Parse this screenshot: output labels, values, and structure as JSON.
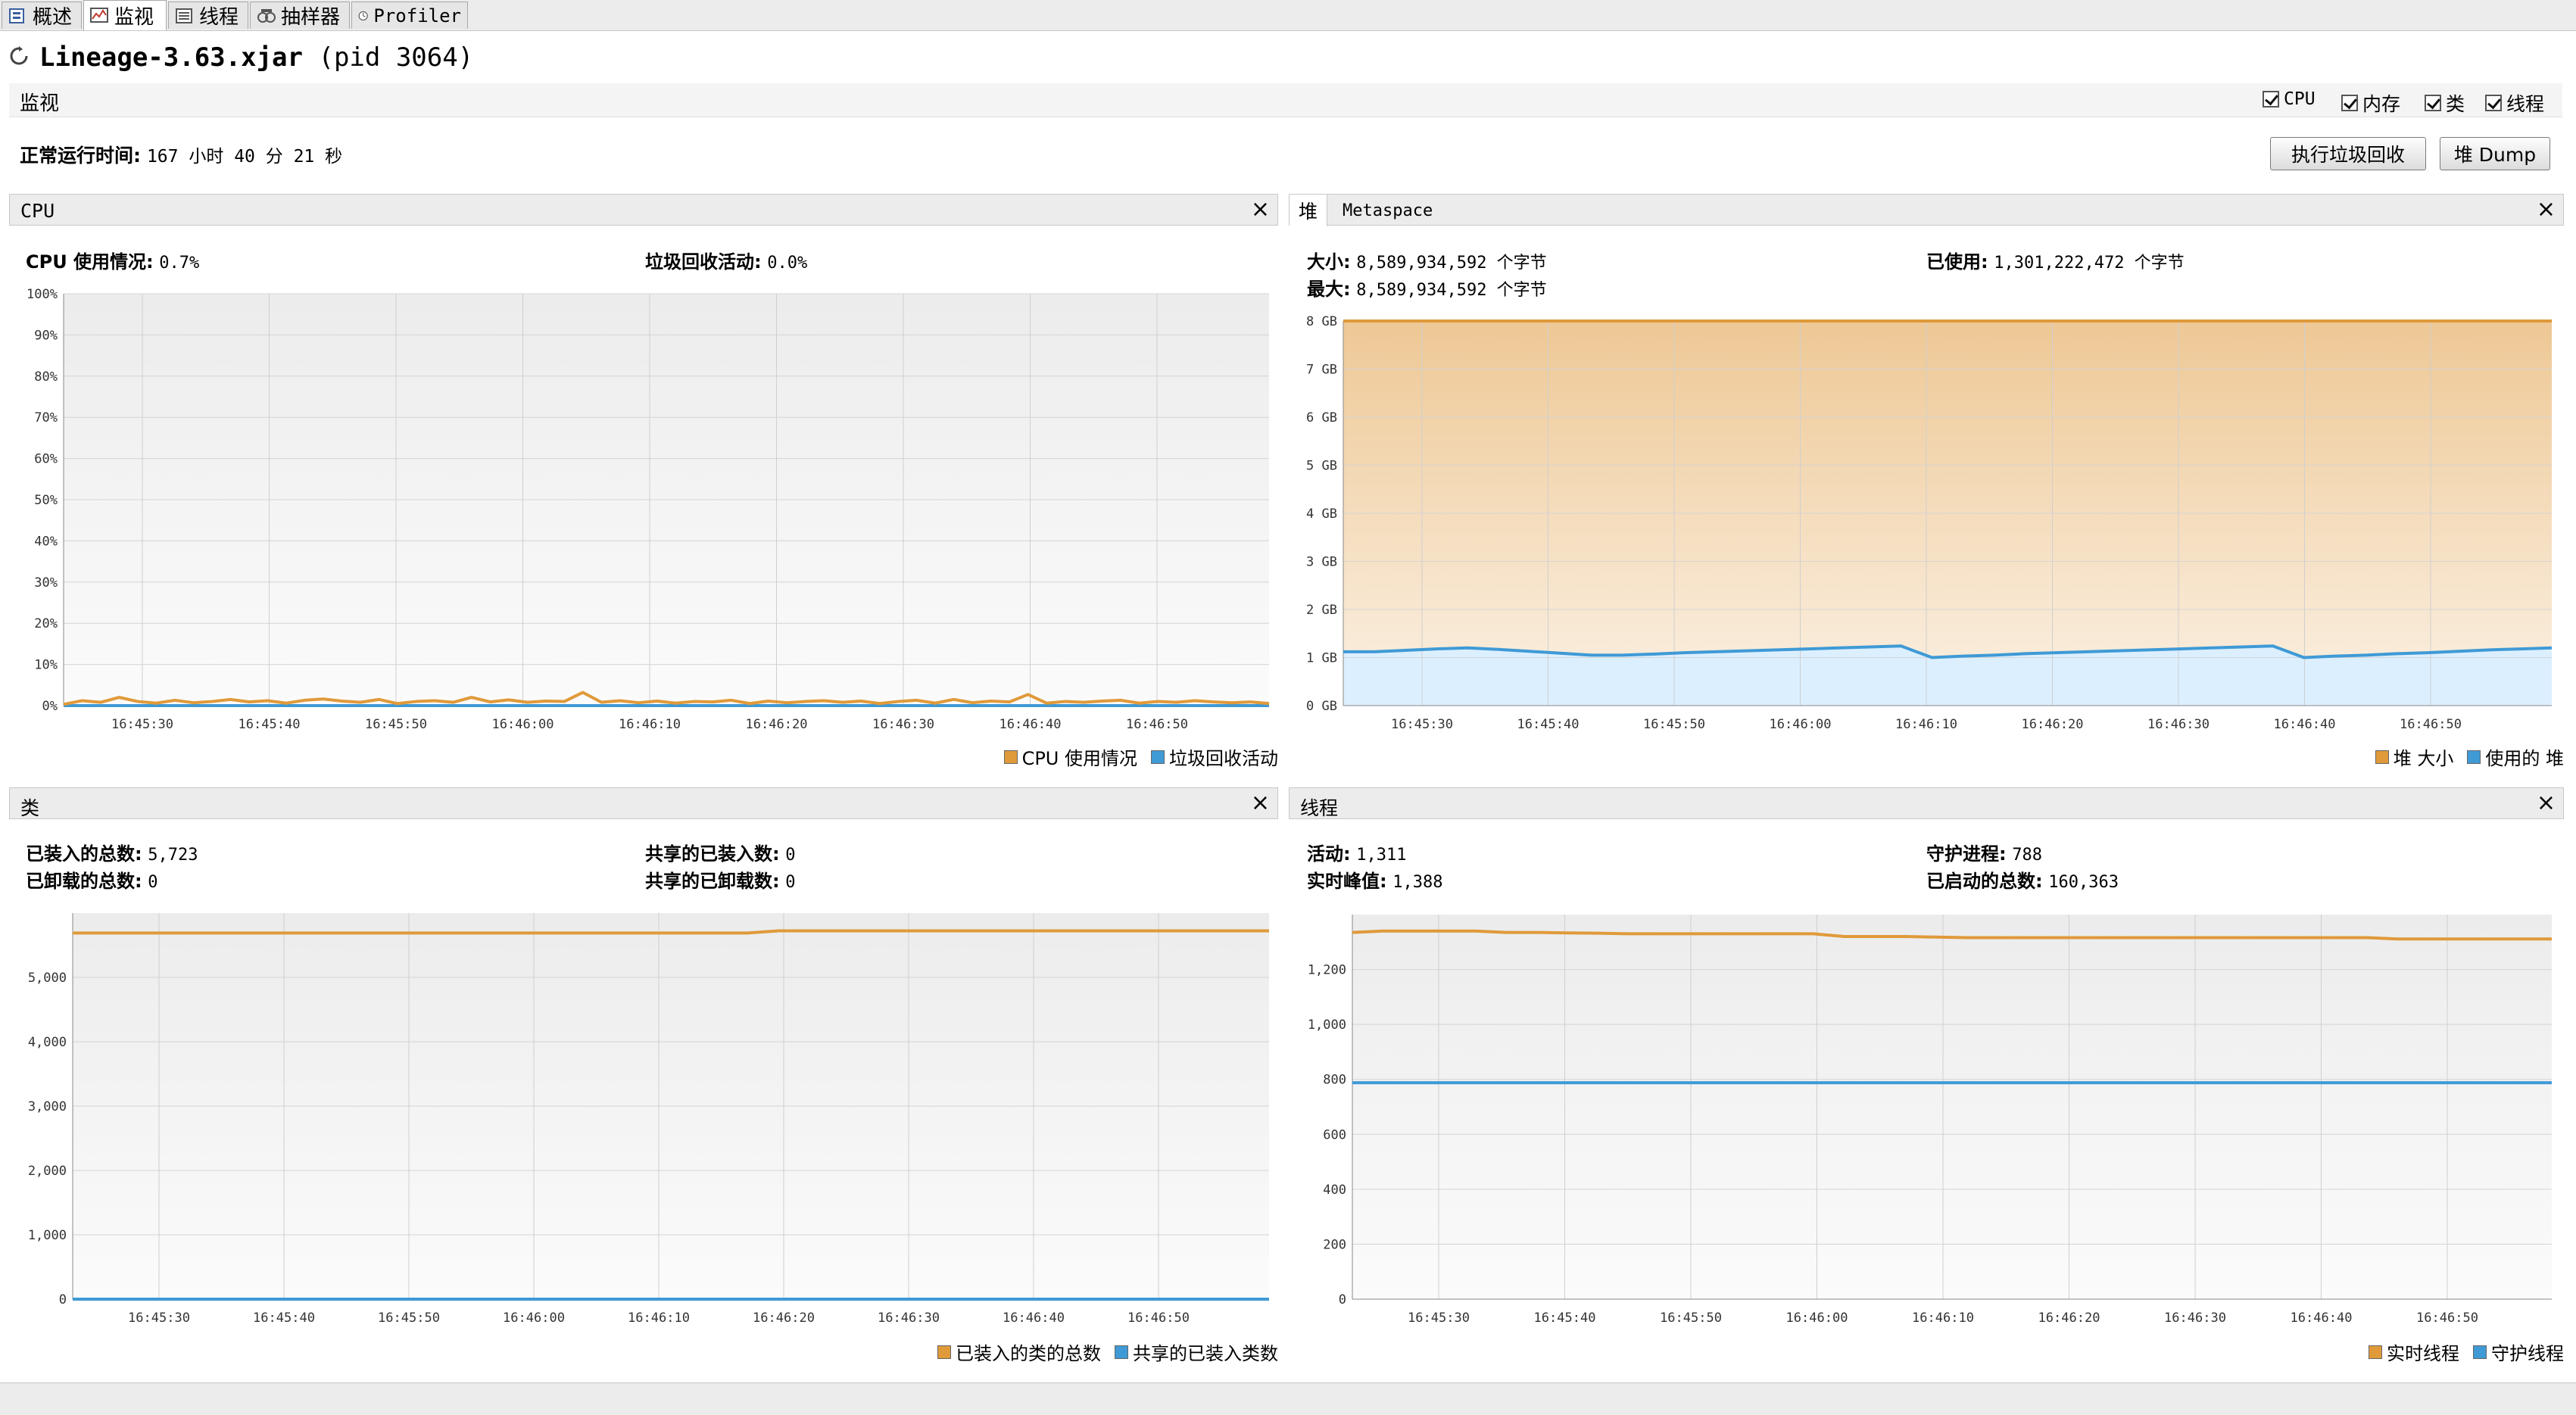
{
  "tabs": [
    {
      "label": "概述",
      "icon": "overview-icon"
    },
    {
      "label": "监视",
      "icon": "monitor-chart-icon"
    },
    {
      "label": "线程",
      "icon": "threads-icon"
    },
    {
      "label": "抽样器",
      "icon": "sampler-icon"
    },
    {
      "label": "Profiler",
      "icon": "profiler-clock-icon"
    }
  ],
  "app": {
    "name": "Lineage-3.63.xjar",
    "pid": "(pid 3064)"
  },
  "section": {
    "label": "监视"
  },
  "toggles": [
    {
      "label": "CPU",
      "checked": true
    },
    {
      "label": "内存",
      "checked": true
    },
    {
      "label": "类",
      "checked": true
    },
    {
      "label": "线程",
      "checked": true
    }
  ],
  "uptime": {
    "label": "正常运行时间:",
    "value": "167 小时 40 分 21 秒"
  },
  "buttons": {
    "gc": "执行垃圾回收",
    "heap_dump": "堆 Dump"
  },
  "colors": {
    "orange": "#e09a3a",
    "blue": "#3f9ad6"
  },
  "cpu": {
    "title": "CPU",
    "usage_label": "CPU 使用情况:",
    "usage_value": "0.7%",
    "gc_label": "垃圾回收活动:",
    "gc_value": "0.0%",
    "legend": [
      "CPU 使用情况",
      "垃圾回收活动"
    ]
  },
  "heap": {
    "tabs": [
      "堆",
      "Metaspace"
    ],
    "size_label": "大小:",
    "size_value": "8,589,934,592 个字节",
    "max_label": "最大:",
    "max_value": "8,589,934,592 个字节",
    "used_label": "已使用:",
    "used_value": "1,301,222,472 个字节",
    "legend": [
      "堆 大小",
      "使用的 堆"
    ]
  },
  "classes": {
    "title": "类",
    "loaded_label": "已装入的总数:",
    "loaded_value": "5,723",
    "unloaded_label": "已卸载的总数:",
    "unloaded_value": "0",
    "shared_loaded_label": "共享的已装入数:",
    "shared_loaded_value": "0",
    "shared_unloaded_label": "共享的已卸载数:",
    "shared_unloaded_value": "0",
    "legend": [
      "已装入的类的总数",
      "共享的已装入类数"
    ]
  },
  "threads": {
    "title": "线程",
    "live_label": "活动:",
    "live_value": "1,311",
    "peak_label": "实时峰值:",
    "peak_value": "1,388",
    "daemon_label": "守护进程:",
    "daemon_value": "788",
    "started_label": "已启动的总数:",
    "started_value": "160,363",
    "legend": [
      "实时线程",
      "守护线程"
    ]
  },
  "chart_data": [
    {
      "type": "line",
      "name": "cpu",
      "x_ticks": [
        "16:45:30",
        "16:45:40",
        "16:45:50",
        "16:46:00",
        "16:46:10",
        "16:46:20",
        "16:46:30",
        "16:46:40",
        "16:46:50"
      ],
      "y_ticks": [
        "0%",
        "10%",
        "20%",
        "30%",
        "40%",
        "50%",
        "60%",
        "70%",
        "80%",
        "90%",
        "100%"
      ],
      "ylim": [
        0,
        100
      ],
      "series": [
        {
          "name": "CPU 使用情况",
          "color": "#e09a3a",
          "values": [
            0.3,
            1.2,
            0.8,
            2,
            1,
            0.6,
            1.3,
            0.7,
            1,
            1.5,
            0.9,
            1.2,
            0.6,
            1.3,
            1.6,
            1.1,
            0.8,
            1.5,
            0.5,
            1,
            1.2,
            0.8,
            2,
            0.9,
            1.4,
            0.8,
            1.1,
            1,
            3.2,
            0.8,
            1.2,
            0.7,
            1.1,
            0.6,
            1,
            0.9,
            1.3,
            0.5,
            1.1,
            0.7,
            1,
            1.2,
            0.8,
            1.1,
            0.5,
            1,
            1.3,
            0.6,
            1.5,
            0.7,
            1.1,
            0.9,
            2.7,
            0.6,
            1,
            0.8,
            1.1,
            1.3,
            0.6,
            1,
            0.8,
            1.2,
            0.9,
            0.7,
            0.9,
            0.5
          ]
        },
        {
          "name": "垃圾回收活动",
          "color": "#3f9ad6",
          "values": [
            0,
            0,
            0,
            0,
            0,
            0,
            0,
            0,
            0,
            0,
            0,
            0,
            0,
            0,
            0,
            0,
            0,
            0,
            0,
            0
          ]
        }
      ]
    },
    {
      "type": "area",
      "name": "heap",
      "x_ticks": [
        "16:45:30",
        "16:45:40",
        "16:45:50",
        "16:46:00",
        "16:46:10",
        "16:46:20",
        "16:46:30",
        "16:46:40",
        "16:46:50"
      ],
      "y_ticks": [
        "0 GB",
        "1 GB",
        "2 GB",
        "3 GB",
        "4 GB",
        "5 GB",
        "6 GB",
        "7 GB",
        "8 GB"
      ],
      "ylim": [
        0,
        8
      ],
      "series": [
        {
          "name": "堆 大小",
          "color": "#e09a3a",
          "values": [
            8,
            8,
            8,
            8,
            8,
            8,
            8,
            8,
            8,
            8,
            8,
            8,
            8,
            8,
            8,
            8,
            8,
            8,
            8,
            8
          ]
        },
        {
          "name": "使用的 堆",
          "color": "#3f9ad6",
          "values": [
            1.12,
            1.12,
            1.15,
            1.18,
            1.2,
            1.17,
            1.13,
            1.09,
            1.05,
            1.05,
            1.07,
            1.1,
            1.12,
            1.14,
            1.16,
            1.18,
            1.2,
            1.22,
            1.24,
            1.0,
            1.03,
            1.05,
            1.08,
            1.1,
            1.12,
            1.14,
            1.16,
            1.18,
            1.2,
            1.22,
            1.24,
            1.0,
            1.03,
            1.05,
            1.08,
            1.1,
            1.13,
            1.16,
            1.18,
            1.2
          ]
        }
      ]
    },
    {
      "type": "line",
      "name": "classes",
      "x_ticks": [
        "16:45:30",
        "16:45:40",
        "16:45:50",
        "16:46:00",
        "16:46:10",
        "16:46:20",
        "16:46:30",
        "16:46:40",
        "16:46:50"
      ],
      "y_ticks": [
        "0",
        "1,000",
        "2,000",
        "3,000",
        "4,000",
        "5,000"
      ],
      "ylim": [
        0,
        6000
      ],
      "series": [
        {
          "name": "已装入的类的总数",
          "color": "#e09a3a",
          "values": [
            5690,
            5690,
            5690,
            5690,
            5690,
            5690,
            5690,
            5690,
            5690,
            5690,
            5690,
            5690,
            5690,
            5690,
            5690,
            5690,
            5690,
            5690,
            5690,
            5690,
            5690,
            5690,
            5690,
            5723,
            5723,
            5723,
            5723,
            5723,
            5723,
            5723,
            5723,
            5723,
            5723,
            5723,
            5723,
            5723,
            5723,
            5723,
            5723,
            5723
          ]
        },
        {
          "name": "共享的已装入类数",
          "color": "#3f9ad6",
          "values": [
            0,
            0,
            0,
            0,
            0,
            0,
            0,
            0,
            0,
            0,
            0,
            0,
            0,
            0,
            0,
            0,
            0,
            0,
            0,
            0
          ]
        }
      ]
    },
    {
      "type": "line",
      "name": "threads",
      "x_ticks": [
        "16:45:30",
        "16:45:40",
        "16:45:50",
        "16:46:00",
        "16:46:10",
        "16:46:20",
        "16:46:30",
        "16:46:40",
        "16:46:50"
      ],
      "y_ticks": [
        "0",
        "200",
        "400",
        "600",
        "800",
        "1,000",
        "1,200"
      ],
      "ylim": [
        0,
        1400
      ],
      "series": [
        {
          "name": "实时线程",
          "color": "#e09a3a",
          "values": [
            1335,
            1340,
            1340,
            1340,
            1340,
            1335,
            1335,
            1333,
            1332,
            1330,
            1330,
            1330,
            1330,
            1330,
            1330,
            1330,
            1320,
            1320,
            1320,
            1318,
            1316,
            1316,
            1316,
            1316,
            1316,
            1316,
            1316,
            1316,
            1316,
            1316,
            1316,
            1316,
            1316,
            1316,
            1311,
            1311,
            1311,
            1311,
            1311,
            1311
          ]
        },
        {
          "name": "守护线程",
          "color": "#3f9ad6",
          "values": [
            788,
            788,
            788,
            788,
            788,
            788,
            788,
            788,
            788,
            788,
            788,
            788,
            788,
            788,
            788,
            788,
            788,
            788,
            788,
            788
          ]
        }
      ]
    }
  ]
}
